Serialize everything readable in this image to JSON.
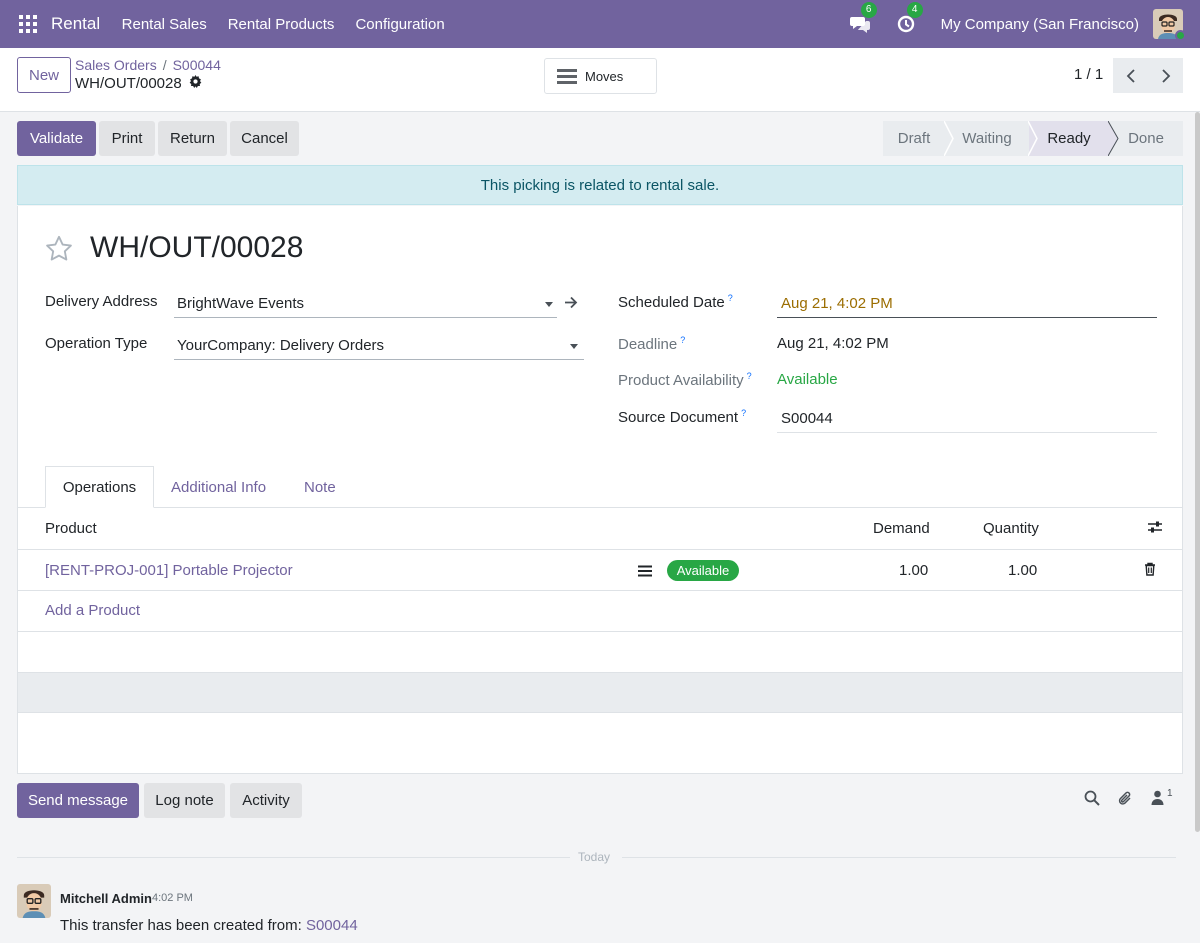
{
  "navbar": {
    "app_name": "Rental",
    "menu": [
      "Rental Sales",
      "Rental Products",
      "Configuration"
    ],
    "messages_count": "6",
    "activities_count": "4",
    "company": "My Company (San Francisco)"
  },
  "control_panel": {
    "new_label": "New",
    "breadcrumb": [
      "Sales Orders",
      "S00044"
    ],
    "record_name": "WH/OUT/00028",
    "moves_label": "Moves",
    "pager": "1 / 1"
  },
  "actions": {
    "validate": "Validate",
    "print": "Print",
    "return": "Return",
    "cancel": "Cancel"
  },
  "statusbar": {
    "stages": [
      "Draft",
      "Waiting",
      "Ready",
      "Done"
    ],
    "active": "Ready"
  },
  "alert": "This picking is related to rental sale.",
  "form": {
    "title": "WH/OUT/00028",
    "delivery_address_label": "Delivery Address",
    "delivery_address": "BrightWave Events",
    "operation_type_label": "Operation Type",
    "operation_type": "YourCompany: Delivery Orders",
    "scheduled_date_label": "Scheduled Date",
    "scheduled_date": "Aug 21, 4:02 PM",
    "deadline_label": "Deadline",
    "deadline": "Aug 21, 4:02 PM",
    "availability_label": "Product Availability",
    "availability": "Available",
    "source_document_label": "Source Document",
    "source_document": "S00044",
    "help_mark": "?"
  },
  "tabs": [
    "Operations",
    "Additional Info",
    "Note"
  ],
  "table": {
    "headers": {
      "product": "Product",
      "demand": "Demand",
      "quantity": "Quantity"
    },
    "rows": [
      {
        "product": "[RENT-PROJ-001] Portable Projector",
        "status": "Available",
        "demand": "1.00",
        "quantity": "1.00"
      }
    ],
    "add_line": "Add a Product"
  },
  "chatter": {
    "send_message": "Send message",
    "log_note": "Log note",
    "activity": "Activity",
    "followers_count": "1",
    "date_separator": "Today",
    "message": {
      "author": "Mitchell Admin",
      "time": "4:02 PM",
      "text": "This transfer has been created from: ",
      "link": "S00044"
    }
  },
  "colors": {
    "brand": "#71639e",
    "success": "#28a745",
    "warning_date": "#9b6d00",
    "alert_bg": "#d4ecf1"
  },
  "icons": [
    "apps-grid-icon",
    "chat-icon",
    "clock-icon",
    "gear-icon",
    "moves-list-icon",
    "chevron-left-icon",
    "chevron-right-icon",
    "star-icon",
    "external-link-arrow-icon",
    "caret-down-icon",
    "optional-columns-icon",
    "forecast-lines-icon",
    "trash-icon",
    "search-icon",
    "paperclip-icon",
    "follower-icon"
  ]
}
